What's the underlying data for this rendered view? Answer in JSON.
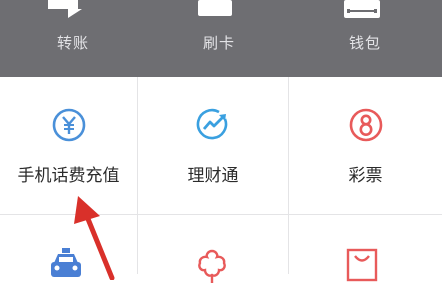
{
  "top_bar": {
    "items": [
      {
        "label": "转账",
        "icon": "transfer-icon"
      },
      {
        "label": "刷卡",
        "icon": "card-swipe-icon"
      },
      {
        "label": "钱包",
        "icon": "wallet-icon"
      }
    ]
  },
  "grid": {
    "row1": [
      {
        "label": "手机话费充值",
        "icon": "yuan-coin-icon",
        "color": "#4a90d9"
      },
      {
        "label": "理财通",
        "icon": "finance-trend-icon",
        "color": "#3aa0e0"
      },
      {
        "label": "彩票",
        "icon": "lottery-icon",
        "color": "#e85a5a"
      }
    ],
    "row2": [
      {
        "icon": "taxi-icon",
        "color": "#4a7fd4"
      },
      {
        "icon": "flower-icon",
        "color": "#e85a5a"
      },
      {
        "icon": "shopping-bag-icon",
        "color": "#e85a5a"
      }
    ]
  },
  "annotation": {
    "icon": "red-arrow-icon",
    "color": "#d9302a"
  }
}
